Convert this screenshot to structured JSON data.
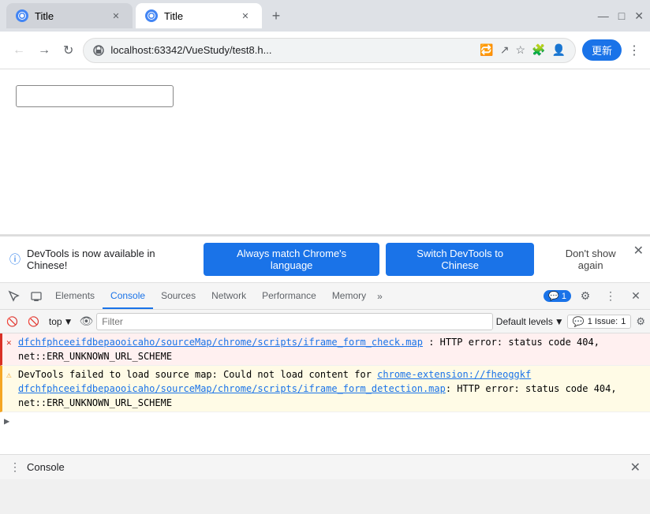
{
  "tabs": [
    {
      "id": "tab1",
      "title": "Title",
      "active": false
    },
    {
      "id": "tab2",
      "title": "Title",
      "active": true
    }
  ],
  "new_tab_label": "+",
  "window_controls": {
    "minimize": "—",
    "maximize": "□",
    "close": "✕"
  },
  "address_bar": {
    "url": "localhost:63342/VueStudy/test8.h...",
    "reload_icon": "↻",
    "back_icon": "←",
    "forward_icon": "→"
  },
  "update_button_label": "更新",
  "banner": {
    "text": "DevTools is now available in Chinese!",
    "btn1": "Always match Chrome's language",
    "btn2": "Switch DevTools to Chinese",
    "btn3": "Don't show again"
  },
  "devtools_tabs": [
    {
      "id": "elements",
      "label": "Elements",
      "active": false
    },
    {
      "id": "console",
      "label": "Console",
      "active": true
    },
    {
      "id": "sources",
      "label": "Sources",
      "active": false
    },
    {
      "id": "network",
      "label": "Network",
      "active": false
    },
    {
      "id": "performance",
      "label": "Performance",
      "active": false
    },
    {
      "id": "memory",
      "label": "Memory",
      "active": false
    }
  ],
  "badge_count": "1",
  "filter_bar": {
    "top_label": "top",
    "filter_placeholder": "Filter",
    "default_levels": "Default levels",
    "issue_label": "1 Issue:",
    "issue_count": "1"
  },
  "console_entries": [
    {
      "type": "error",
      "text": "dfchfphceeifdbepaooi caho/sourceMap/chrome/scripts/iframe_form_check.map: HTTP error: status code 404, net::ERR_UNKNOWN_URL_SCHEME",
      "link": "chrome-extension://fheoggkfdfchfphceeifdbepaooi caho/sourceMap/chrome/scripts/iframe_form_check.map"
    },
    {
      "type": "warning",
      "text": "DevTools failed to load source map: Could not load content for chrome-extension://fheoggkfdfchfphceeifdbepaooi caho/sourceMap/chrome/scripts/iframe_form_detection.map: HTTP error: status code 404, net::ERR_UNKNOWN_URL_SCHEME",
      "link": "chrome-extension://fheoggkfdfchfphceeifdbepaooi caho/sourceMap/chrome/scripts/iframe_form_detection.map"
    }
  ],
  "bottom_bar": {
    "icon": "⋮",
    "label": "Console",
    "close": "✕"
  }
}
